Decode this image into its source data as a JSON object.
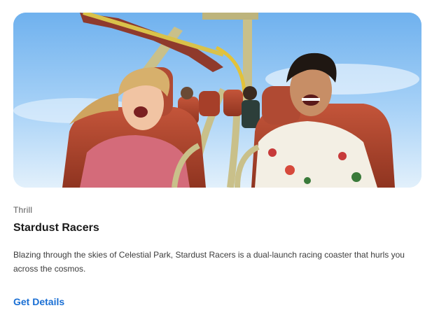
{
  "card": {
    "image_alt": "Riders laughing on the Stardust Racers roller coaster",
    "category": "Thrill",
    "title": "Stardust Racers",
    "description": "Blazing through the skies of Celestial Park, Stardust Racers is a dual-launch racing coaster that hurls you across the cosmos.",
    "cta_label": "Get Details"
  },
  "colors": {
    "link": "#1a6fd4",
    "title": "#1b1b1b",
    "text": "#3c3c3c",
    "category": "#5b5b5b",
    "sky": "#8fc4f3",
    "track": "#c9c08a",
    "seat": "#b5472e"
  }
}
